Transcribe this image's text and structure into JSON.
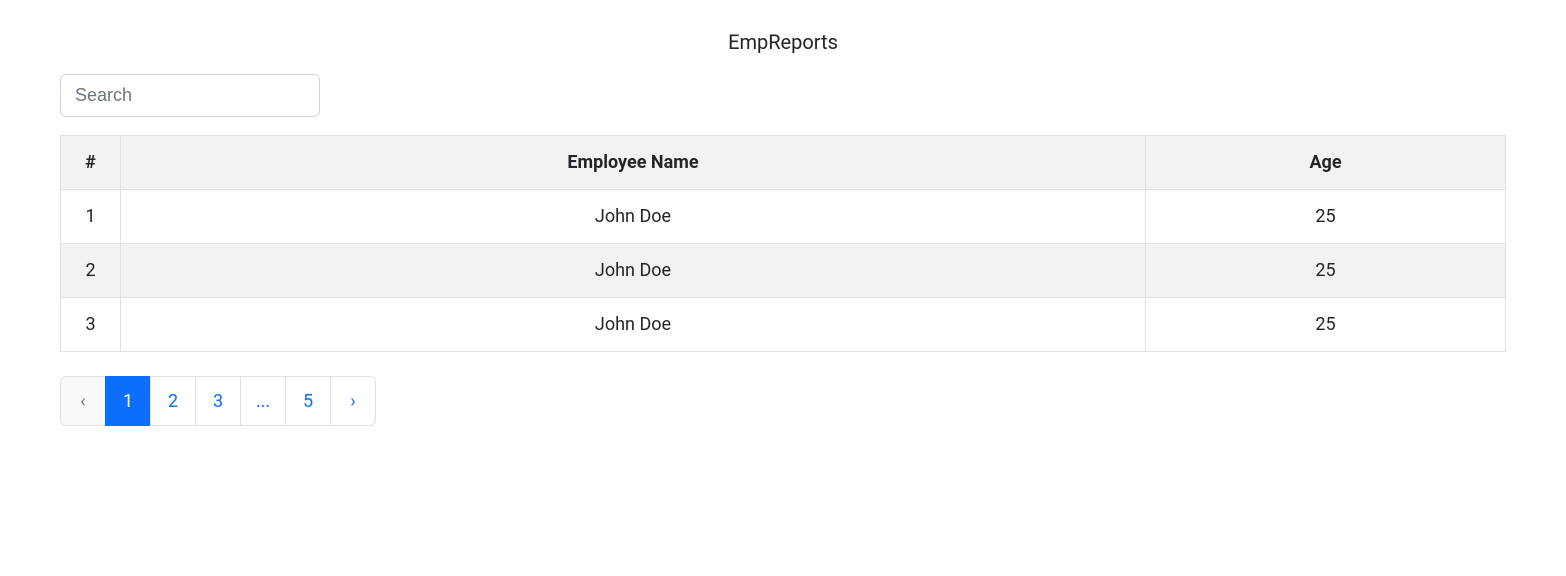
{
  "title": "EmpReports",
  "search": {
    "placeholder": "Search",
    "value": ""
  },
  "table": {
    "headers": {
      "index": "#",
      "name": "Employee Name",
      "age": "Age"
    },
    "rows": [
      {
        "index": "1",
        "name": "John Doe",
        "age": "25"
      },
      {
        "index": "2",
        "name": "John Doe",
        "age": "25"
      },
      {
        "index": "3",
        "name": "John Doe",
        "age": "25"
      }
    ]
  },
  "pagination": {
    "prev": "‹",
    "next": "›",
    "pages": [
      "1",
      "2",
      "3",
      "...",
      "5"
    ],
    "active": "1"
  }
}
